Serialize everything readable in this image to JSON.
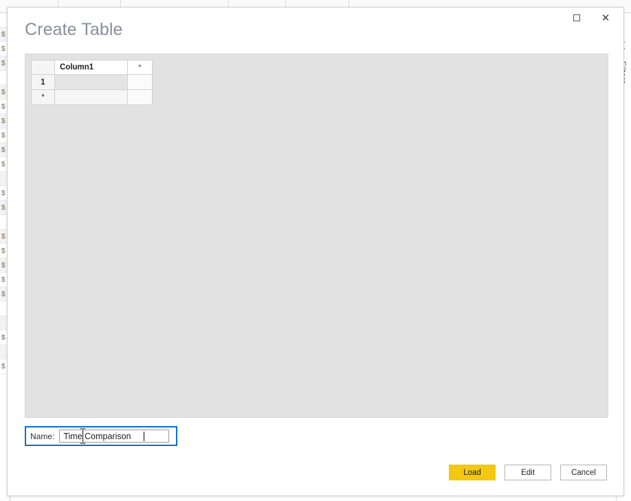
{
  "background": {
    "filters_pane": {
      "label": "Filters",
      "chevron_icon": "chevron-left-icon"
    },
    "left_grid_rows": [
      "",
      "$",
      "$",
      "$",
      "",
      "$",
      "$",
      "$",
      "$",
      "$",
      "$",
      "",
      "$",
      "$",
      "",
      "$",
      "$",
      "$",
      "$",
      "$",
      "",
      "",
      "$",
      "",
      "$"
    ]
  },
  "dialog": {
    "title": "Create Table",
    "window_controls": {
      "maximize": {
        "name": "maximize-icon",
        "glyph": "□"
      },
      "close": {
        "name": "close-icon",
        "glyph": "✕"
      }
    },
    "grid": {
      "columns": [
        "",
        "Column1",
        "*"
      ],
      "header": {
        "selector": "",
        "column1": "Column1",
        "new_column": "*"
      },
      "rows": [
        {
          "marker": "1",
          "bold": true,
          "cells": [
            "",
            ""
          ]
        },
        {
          "marker": "*",
          "bold": false,
          "cells": [
            "",
            ""
          ]
        }
      ]
    },
    "name_field": {
      "label": "Name:",
      "value": "Time Comparison",
      "placeholder": ""
    },
    "buttons": [
      {
        "id": "load",
        "label": "Load",
        "style": "primary"
      },
      {
        "id": "edit",
        "label": "Edit",
        "style": "secondary"
      },
      {
        "id": "cancel",
        "label": "Cancel",
        "style": "secondary"
      }
    ]
  },
  "colors": {
    "accent_yellow": "#F2C811",
    "focus_blue": "#0A70C8",
    "title_gray": "#8A8E99",
    "panel_gray": "#E2E2E2"
  }
}
